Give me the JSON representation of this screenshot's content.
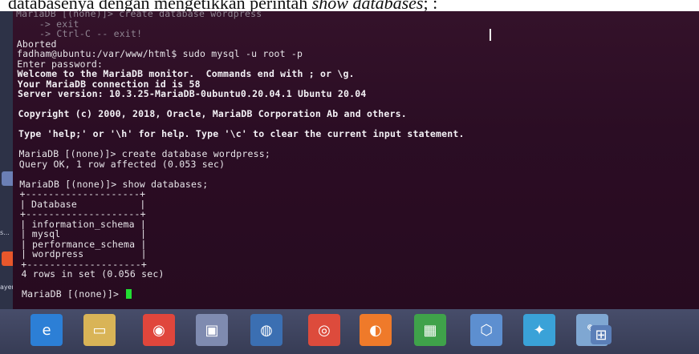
{
  "caption": {
    "text_plain": "databasenya dengan mengetikkan perintah ",
    "text_italic": "show databases",
    "text_tail": "; :"
  },
  "terminal": {
    "lines": [
      "MariaDB [(none)]> create database wordpress",
      "    -> exit",
      "    -> Ctrl-C -- exit!",
      "Aborted",
      "fadham@ubuntu:/var/www/html$ sudo mysql -u root -p",
      "Enter password:",
      "Welcome to the MariaDB monitor.  Commands end with ; or \\g.",
      "Your MariaDB connection id is 58",
      "Server version: 10.3.25-MariaDB-0ubuntu0.20.04.1 Ubuntu 20.04",
      "",
      "Copyright (c) 2000, 2018, Oracle, MariaDB Corporation Ab and others.",
      "",
      "Type 'help;' or '\\h' for help. Type '\\c' to clear the current input statement.",
      "",
      "MariaDB [(none)]> create database wordpress;",
      "Query OK, 1 row affected (0.053 sec)",
      "",
      "MariaDB [(none)]> show databases;",
      "+--------------------+",
      "| Database           |",
      "+--------------------+",
      "| information_schema |",
      "| mysql              |",
      "| performance_schema |",
      "| wordpress          |",
      "+--------------------+",
      "4 rows in set (0.056 sec)",
      "",
      "MariaDB [(none)]> "
    ]
  },
  "sidebar": {
    "labels": [
      "s...",
      "ayer"
    ]
  },
  "taskbar": {
    "icons": [
      "edge-icon",
      "file-explorer-icon",
      "media-icon",
      "window-icon",
      "camera-icon",
      "chrome-icon",
      "firefox-icon",
      "store-icon",
      "virtualbox-icon",
      "settings-icon",
      "paint-icon",
      "network-icon"
    ]
  },
  "colors": {
    "terminal_bg": "#2b0d24",
    "terminal_text": "#e8e6ea",
    "cursor": "#22dd33",
    "taskbar": "#3a3f58"
  }
}
